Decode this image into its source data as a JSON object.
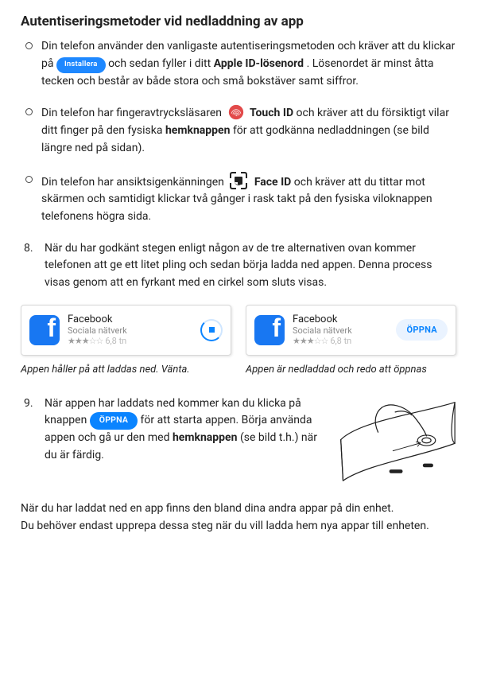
{
  "heading": "Autentiseringsmetoder vid nedladdning av app",
  "bullets": {
    "b1a": "Din telefon använder den vanligaste autentiseringsmetoden och kräver att du klickar på ",
    "b1_pill": "Installera",
    "b1b": " och sedan fyller i ditt ",
    "b1_bold": "Apple ID-lösenord",
    "b1c": ". Lösenordet är minst åtta tecken och består av både stora och små bokstäver samt siffror.",
    "b2a": "Din telefon har fingeravtrycksläsaren ",
    "b2_bold1": "Touch ID",
    "b2b": " och kräver att du försiktigt vilar ditt finger på den fysiska ",
    "b2_bold2": "hemknappen",
    "b2c": " för att godkänna nedladdningen (se bild längre ned på sidan).",
    "b3a": "Din telefon har ansiktsigenkänningen ",
    "b3_bold": "Face ID",
    "b3b": " och kräver att du tittar mot skärmen och samtidigt klickar två gånger i rask takt på den fysiska viloknappen telefonens högra sida."
  },
  "step8": "När du har godkänt stegen enligt någon av de tre alternativen ovan kommer telefonen att ge ett litet pling och sedan börja ladda ned appen. Denna process visas genom att en fyrkant med en cirkel som sluts visas.",
  "card": {
    "name": "Facebook",
    "category": "Sociala nätverk",
    "rating_count": "6,8 tn",
    "open_label": "ÖPPNA"
  },
  "caption_left": "Appen håller på att laddas ned. Vänta.",
  "caption_right": "Appen är nedladdad och redo att öppnas",
  "step9": {
    "a": "När appen har laddats ned kommer kan du klicka på knappen ",
    "pill": "ÖPPNA",
    "b": " för att starta appen. Börja använda appen och gå ur den med ",
    "bold": "hemknappen",
    "c": " (se bild t.h.) när du är färdig."
  },
  "outro1": "När du har laddat ned en app finns den bland dina andra appar på din enhet.",
  "outro2": "Du behöver endast upprepa dessa steg när du vill ladda hem nya appar till enheten."
}
